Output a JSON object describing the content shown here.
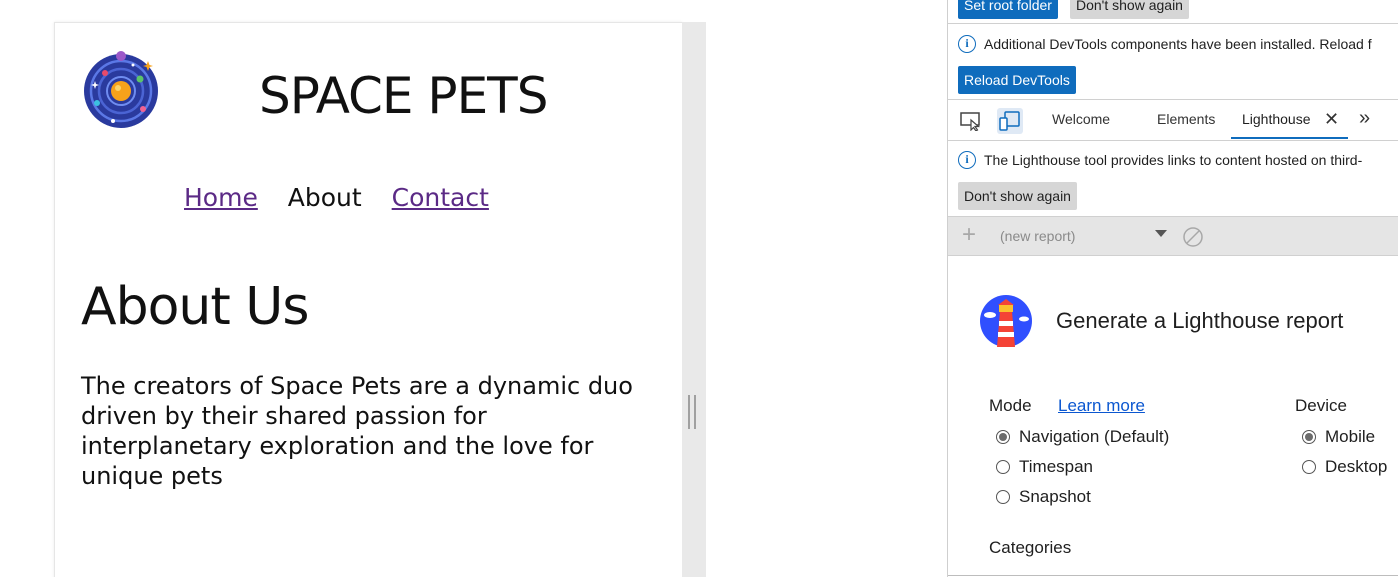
{
  "page": {
    "site_title": "SPACE PETS",
    "nav": {
      "home": "Home",
      "about": "About",
      "contact": "Contact"
    },
    "heading": "About Us",
    "body": "The creators of Space Pets are a dynamic duo driven by their shared passion for interplanetary exploration and the love for unique pets",
    "logo_icon": "galaxy-logo-icon",
    "link_color": "#5b2a86"
  },
  "devtools": {
    "top_buttons": {
      "set_root_folder": "Set root folder",
      "dont_show_again": "Don't show again"
    },
    "notice1": {
      "text": "Additional DevTools components have been installed. Reload f",
      "reload_button": "Reload DevTools"
    },
    "tabs": {
      "welcome": "Welcome",
      "elements": "Elements",
      "lighthouse": "Lighthouse"
    },
    "notice2": {
      "text": "The Lighthouse tool provides links to content hosted on third-",
      "dont_show_again": "Don't show again"
    },
    "toolbar": {
      "report_select": "(new report)"
    },
    "lighthouse": {
      "title": "Generate a Lighthouse report",
      "mode_label": "Mode",
      "learn_more": "Learn more",
      "modes": [
        "Navigation (Default)",
        "Timespan",
        "Snapshot"
      ],
      "selected_mode": "Navigation (Default)",
      "device_label": "Device",
      "devices": [
        "Mobile",
        "Desktop"
      ],
      "selected_device": "Mobile",
      "categories_label": "Categories"
    },
    "accent_color": "#0f6cbd"
  }
}
